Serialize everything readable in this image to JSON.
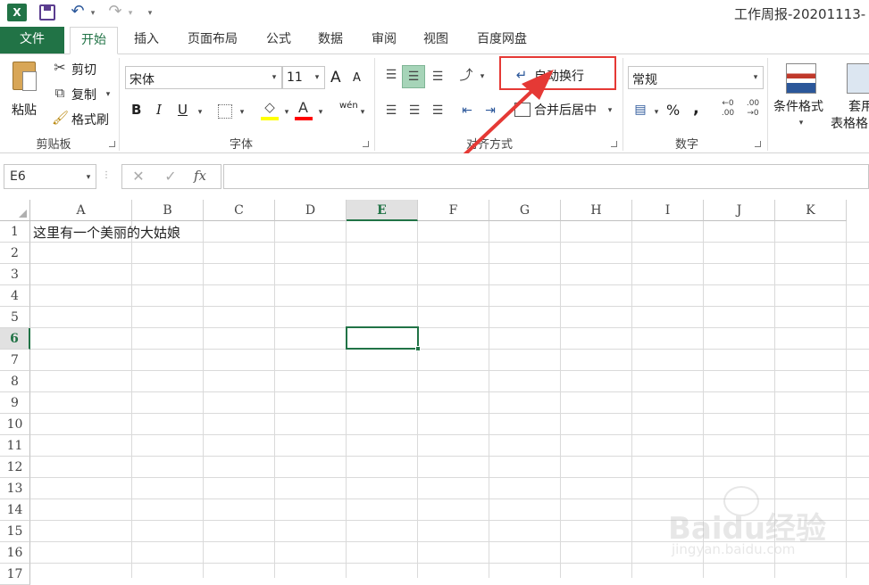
{
  "window": {
    "title": "工作周报-20201113-"
  },
  "tabs": [
    {
      "label": "文件"
    },
    {
      "label": "开始"
    },
    {
      "label": "插入"
    },
    {
      "label": "页面布局"
    },
    {
      "label": "公式"
    },
    {
      "label": "数据"
    },
    {
      "label": "审阅"
    },
    {
      "label": "视图"
    },
    {
      "label": "百度网盘"
    }
  ],
  "clipboard": {
    "paste": "粘贴",
    "cut": "剪切",
    "copy": "复制",
    "format_painter": "格式刷",
    "group": "剪贴板"
  },
  "font": {
    "name": "宋体",
    "size": "11",
    "group": "字体",
    "bold": "B",
    "italic": "I",
    "underline": "U",
    "grow": "A",
    "shrink": "A",
    "phonetic": "wén"
  },
  "alignment": {
    "wrap_text": "自动换行",
    "merge_center": "合并后居中",
    "group": "对齐方式"
  },
  "number": {
    "format": "常规",
    "percent": "%",
    "comma": ",",
    "group": "数字"
  },
  "styles": {
    "conditional": "条件格式",
    "table_format_1": "套用",
    "table_format_2": "表格格"
  },
  "formula_bar": {
    "name_box": "E6",
    "fx": "fx",
    "cancel": "✕",
    "confirm": "✓",
    "content": ""
  },
  "columns": [
    "A",
    "B",
    "C",
    "D",
    "E",
    "F",
    "G",
    "H",
    "I",
    "J",
    "K"
  ],
  "rows": [
    "1",
    "2",
    "3",
    "4",
    "5",
    "6",
    "7",
    "8",
    "9",
    "10",
    "11",
    "12",
    "13",
    "14",
    "15",
    "16",
    "17"
  ],
  "cells": {
    "A1": "这里有一个美丽的大姑娘"
  },
  "selected_cell": "E6",
  "watermark": {
    "line1": "Baidu经验",
    "line2": "jingyan.baidu.com"
  },
  "colors": {
    "excel_green": "#217346",
    "highlight_red": "#e53935",
    "fill_yellow": "#ffff00",
    "font_red": "#ff0000"
  }
}
